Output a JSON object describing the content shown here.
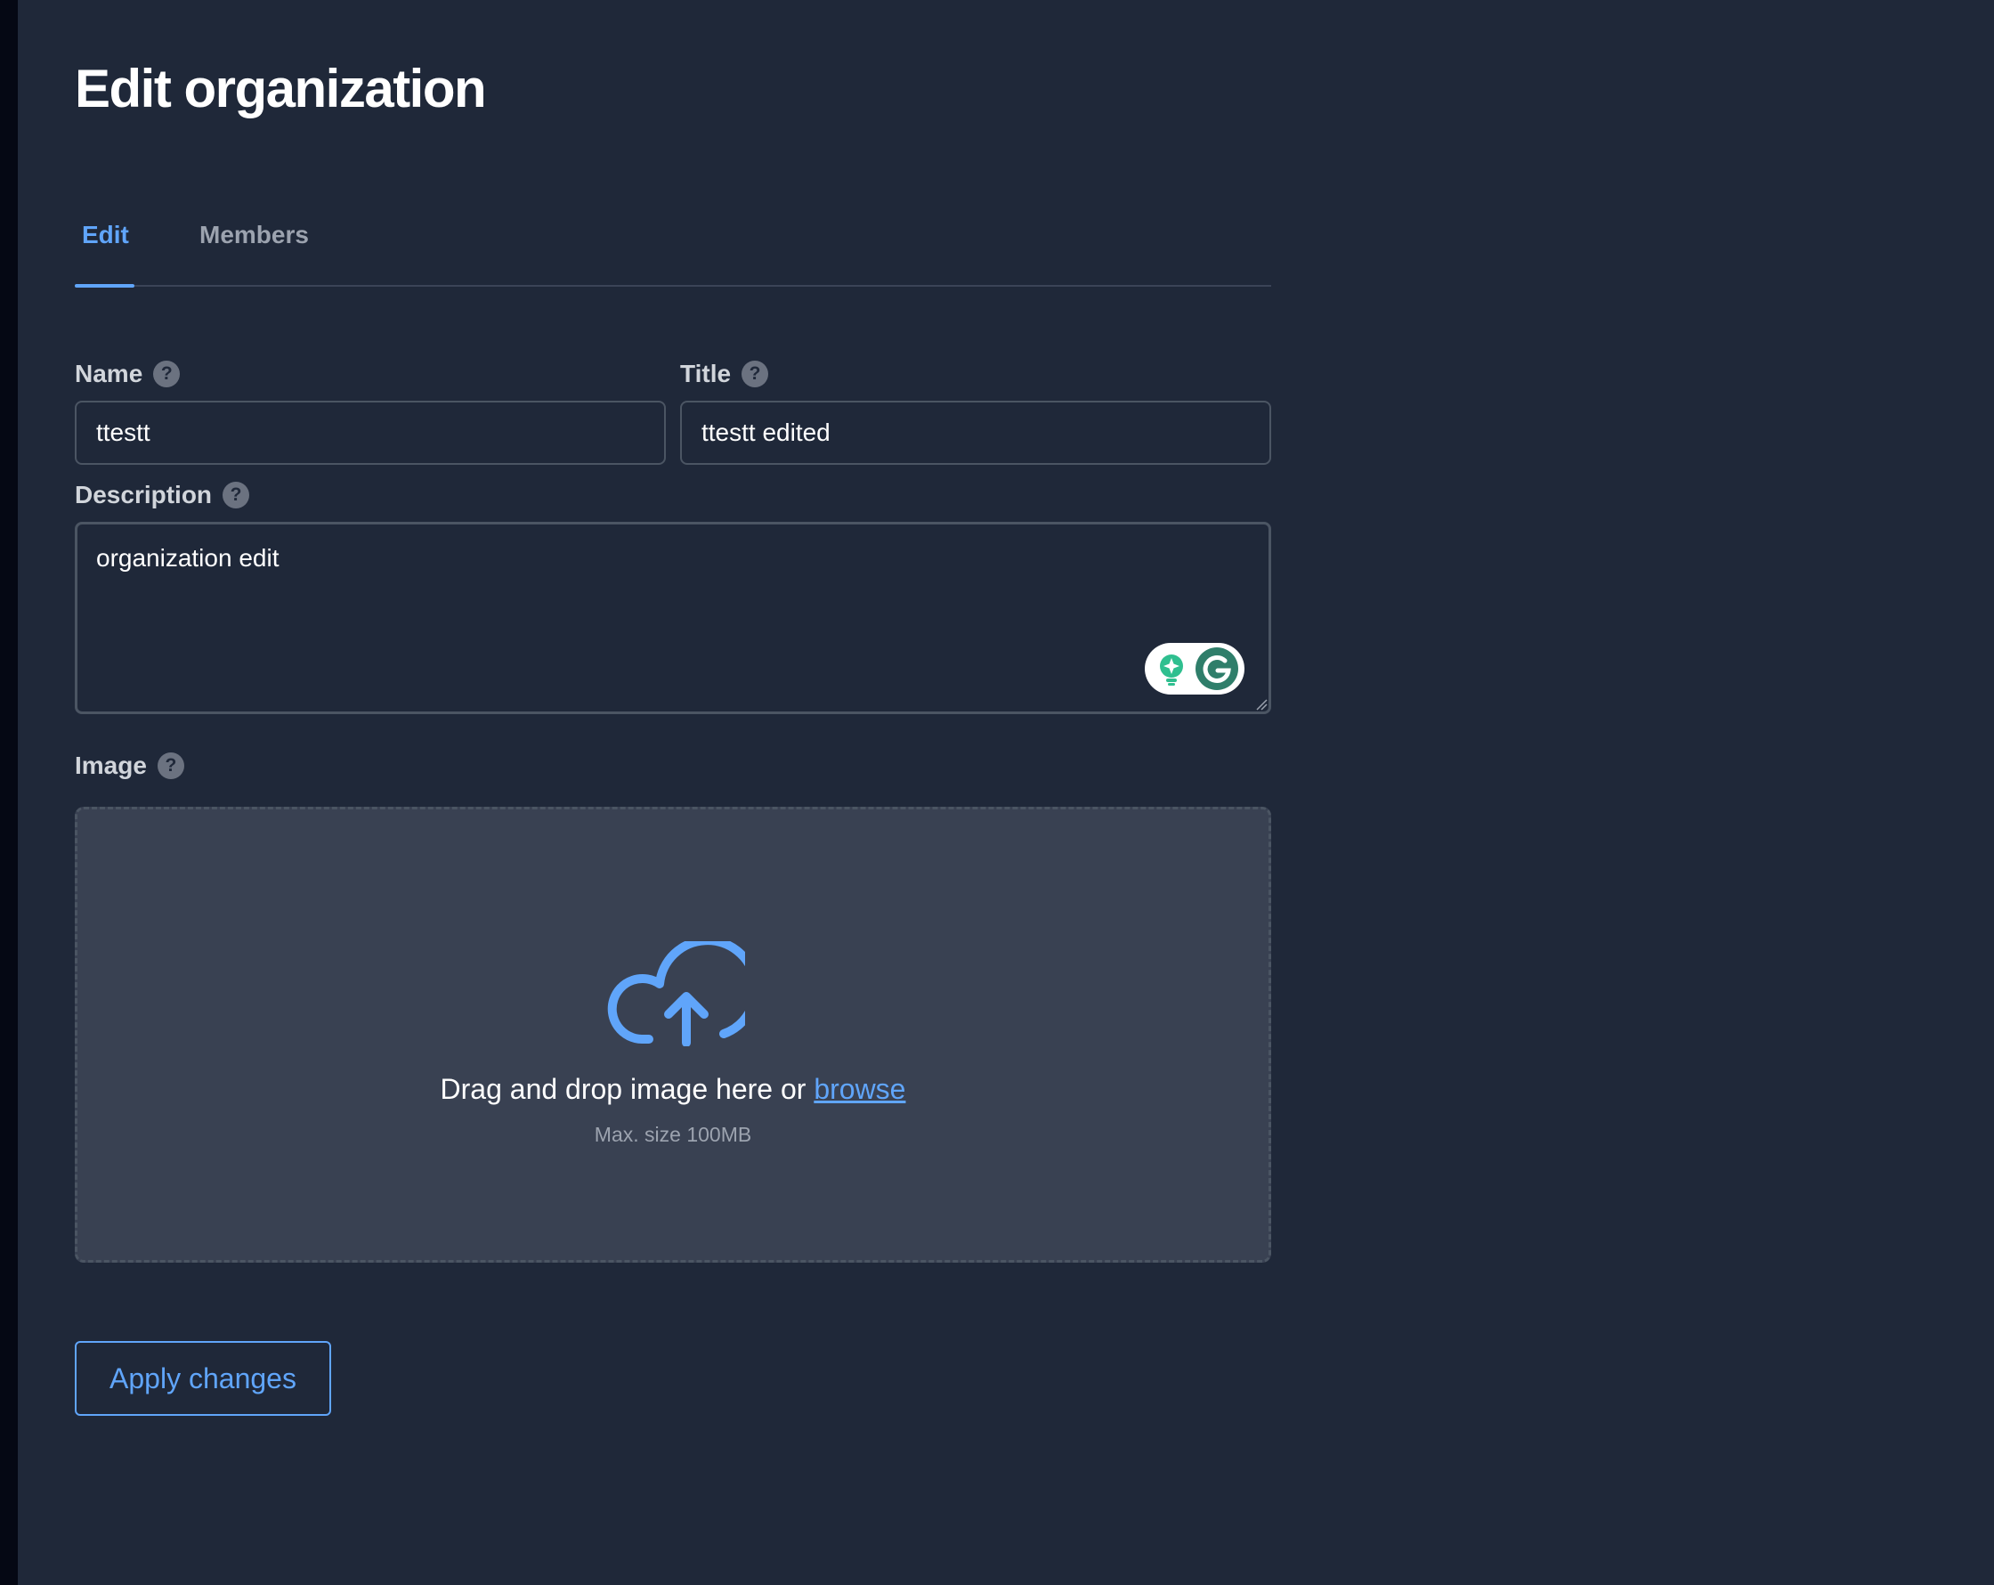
{
  "page": {
    "title": "Edit organization"
  },
  "tabs": [
    {
      "label": "Edit",
      "active": true
    },
    {
      "label": "Members",
      "active": false
    }
  ],
  "form": {
    "name": {
      "label": "Name",
      "value": "ttestt",
      "help": "?"
    },
    "title": {
      "label": "Title",
      "value": "ttestt edited",
      "help": "?"
    },
    "description": {
      "label": "Description",
      "value": "organization edit",
      "help": "?"
    },
    "image": {
      "label": "Image",
      "help": "?",
      "drop_text": "Drag and drop image here or ",
      "browse_label": "browse",
      "max_size": "Max. size 100MB"
    }
  },
  "actions": {
    "apply_label": "Apply changes"
  },
  "colors": {
    "background": "#1f2839",
    "accent": "#60a5fa",
    "dropzone": "#394152",
    "grammarly_green": "#15c39a"
  },
  "icons": {
    "help": "question-circle-icon",
    "upload": "cloud-upload-icon",
    "grammarly": "grammarly-icon"
  }
}
